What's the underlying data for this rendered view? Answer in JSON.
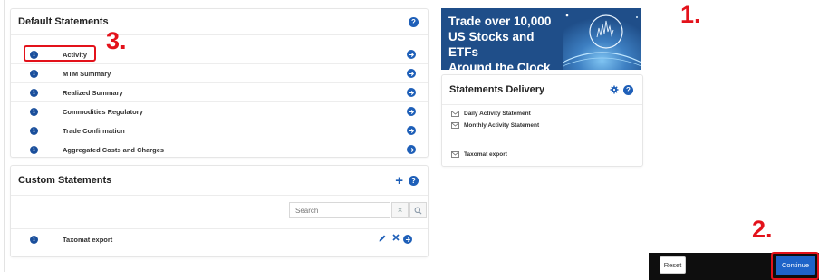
{
  "default_statements": {
    "title": "Default Statements",
    "help": "?",
    "rows": [
      {
        "label": "Activity"
      },
      {
        "label": "MTM Summary"
      },
      {
        "label": "Realized Summary"
      },
      {
        "label": "Commodities Regulatory"
      },
      {
        "label": "Trade Confirmation"
      },
      {
        "label": "Aggregated Costs and Charges"
      }
    ]
  },
  "custom_statements": {
    "title": "Custom Statements",
    "add": "+",
    "help": "?",
    "search": {
      "placeholder": "Search",
      "clear": "×"
    },
    "rows": [
      {
        "label": "Taxomat export"
      }
    ]
  },
  "promo": {
    "lines": [
      "Trade over 10,000",
      "US Stocks and ETFs",
      "Around the Clock"
    ]
  },
  "statements_delivery": {
    "title": "Statements Delivery",
    "help": "?",
    "items": [
      {
        "label": "Daily Activity Statement"
      },
      {
        "label": "Monthly Activity Statement"
      },
      {
        "label": "Taxomat export"
      }
    ]
  },
  "footer": {
    "reset_label": "Reset",
    "continue_label": "Continue"
  },
  "annotations": {
    "one": "1.",
    "two": "2.",
    "three": "3."
  },
  "info_glyph": "i",
  "colors": {
    "accent": "#1e5fb8",
    "annotation": "#e3121b",
    "footer": "#0e0e0e"
  }
}
